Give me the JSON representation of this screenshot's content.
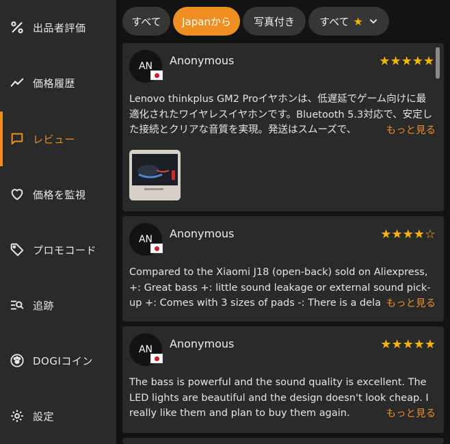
{
  "sidebar": {
    "items": [
      {
        "label": "出品者評価",
        "icon": "percent-icon"
      },
      {
        "label": "価格履歴",
        "icon": "trend-line-icon"
      },
      {
        "label": "レビュー",
        "icon": "chat-bubble-icon",
        "active": true
      },
      {
        "label": "価格を監視",
        "icon": "heart-icon"
      },
      {
        "label": "プロモコード",
        "icon": "tag-icon"
      },
      {
        "label": "追跡",
        "icon": "track-search-icon"
      },
      {
        "label": "DOGIコイン",
        "icon": "paw-icon"
      },
      {
        "label": "設定",
        "icon": "gear-icon"
      }
    ]
  },
  "filters": {
    "all": "すべて",
    "from_japan": "Japanから",
    "with_photos": "写真付き",
    "rating_all": "すべて",
    "star_glyph": "★"
  },
  "reviews": [
    {
      "initials": "AN",
      "author": "Anonymous",
      "stars": "★★★★★",
      "text": "Lenovo thinkplus GM2 Proイヤホンは、低遅延でゲーム向けに最適化されたワイヤレスイヤホンです。Bluetooth 5.3対応で、安定した接続とクリアな音質を実現。発送はスムーズで、",
      "more": "もっと見る",
      "has_photo": true
    },
    {
      "initials": "AN",
      "author": "Anonymous",
      "stars": "★★★★☆",
      "text": "Compared to the Xiaomi J18 (open-back) sold on Aliexpress, +: Great bass +: little sound leakage or external sound pick-up +: Comes with 3 sizes of pads -: There is a delay in operation",
      "more": "もっと見る",
      "has_photo": false
    },
    {
      "initials": "AN",
      "author": "Anonymous",
      "stars": "★★★★★",
      "text": "The bass is powerful and the sound quality is excellent. The LED lights are beautiful and the design doesn't look cheap. I really like them and plan to buy them again.",
      "more": "もっと見る",
      "has_photo": false
    }
  ],
  "colors": {
    "accent": "#ef8f22",
    "star": "#f7b500",
    "sidebar_bg": "#2a2a2a",
    "page_bg": "#131313"
  }
}
